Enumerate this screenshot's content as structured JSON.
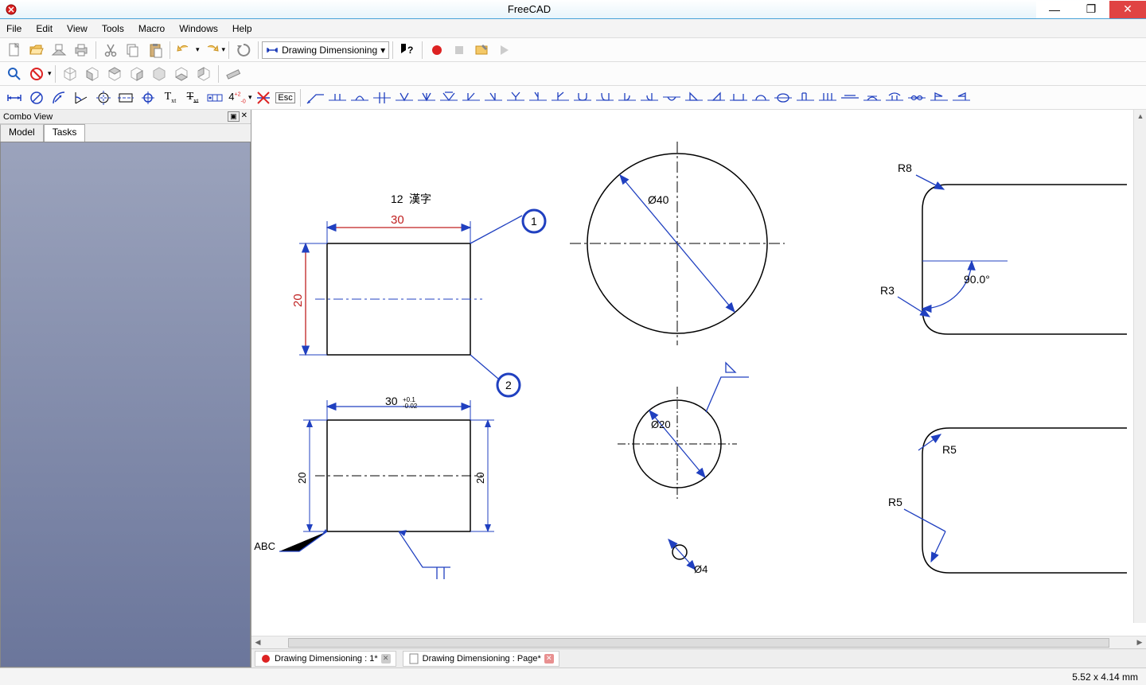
{
  "title": "FreeCAD",
  "menus": {
    "file": "File",
    "edit": "Edit",
    "view": "View",
    "tools": "Tools",
    "macro": "Macro",
    "windows": "Windows",
    "help": "Help"
  },
  "workbench": "Drawing Dimensioning",
  "combo": {
    "header": "Combo View",
    "tab_model": "Model",
    "tab_tasks": "Tasks"
  },
  "drawing": {
    "note1": "12",
    "note2": "漢字",
    "dim30": "30",
    "dim20": "20",
    "balloon1": "1",
    "balloon2": "2",
    "dim30_tol": "30",
    "tol_upper": "+0.1",
    "tol_lower": "-0.02",
    "dim20a": "20",
    "dim20b": "20",
    "abc": "ABC",
    "dia40": "Ø40",
    "dia20": "Ø20",
    "dia4": "Ø4",
    "r8": "R8",
    "r3": "R3",
    "r5a": "R5",
    "r5b": "R5",
    "ang90": "90.0°"
  },
  "docs": {
    "tab1": "Drawing Dimensioning : 1*",
    "tab2": "Drawing Dimensioning : Page*"
  },
  "status": "5.52 x 4.14 mm"
}
